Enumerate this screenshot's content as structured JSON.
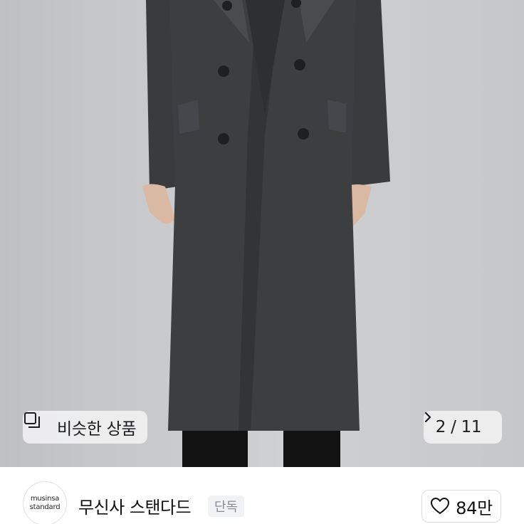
{
  "image": {
    "subject_icon": "coat-product-photo"
  },
  "overlay": {
    "similar_label": "비슷한 상품",
    "similar_icon": "similar-items-icon",
    "current_page": "2",
    "separator": "/",
    "total_pages": "11",
    "next_icon": "chevron-right-icon"
  },
  "brand": {
    "logo_line1": "musinsa",
    "logo_line2": "standard",
    "name": "무신사 스탠다드",
    "badge": "단독"
  },
  "like": {
    "icon": "heart-icon",
    "count": "84만"
  },
  "colors": {
    "coat": "#3b3c3e",
    "background": "#c9cacc",
    "badge_text": "#8a8d93"
  }
}
